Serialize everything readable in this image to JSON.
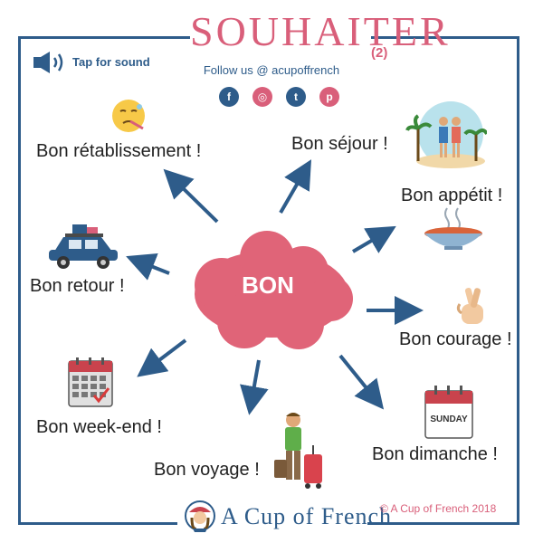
{
  "header": {
    "title": "SOUHAITER",
    "number": "(2)",
    "follow": "Follow us @ acupoffrench"
  },
  "social": [
    {
      "icon": "facebook-icon",
      "glyph": "f",
      "color": "#2e5c8a"
    },
    {
      "icon": "instagram-icon",
      "glyph": "◎",
      "color": "#d95f7a"
    },
    {
      "icon": "twitter-icon",
      "glyph": "t",
      "color": "#2e5c8a"
    },
    {
      "icon": "pinterest-icon",
      "glyph": "p",
      "color": "#d95f7a"
    }
  ],
  "sound": {
    "label": "Tap for sound",
    "icon": "speaker-icon"
  },
  "center": {
    "label": "BON"
  },
  "phrases": {
    "retablissement": "Bon rétablissement !",
    "sejour": "Bon séjour !",
    "appetit": "Bon appétit !",
    "retour": "Bon retour !",
    "courage": "Bon courage !",
    "weekend": "Bon week-end !",
    "voyage": "Bon voyage !",
    "dimanche": "Bon dimanche !"
  },
  "calendar_text": "SUNDAY",
  "footer": {
    "brand": "A Cup of French",
    "copyright": "© A Cup of French 2018"
  },
  "colors": {
    "blue": "#2e5c8a",
    "pink": "#d95f7a",
    "cloud": "#e06478"
  }
}
